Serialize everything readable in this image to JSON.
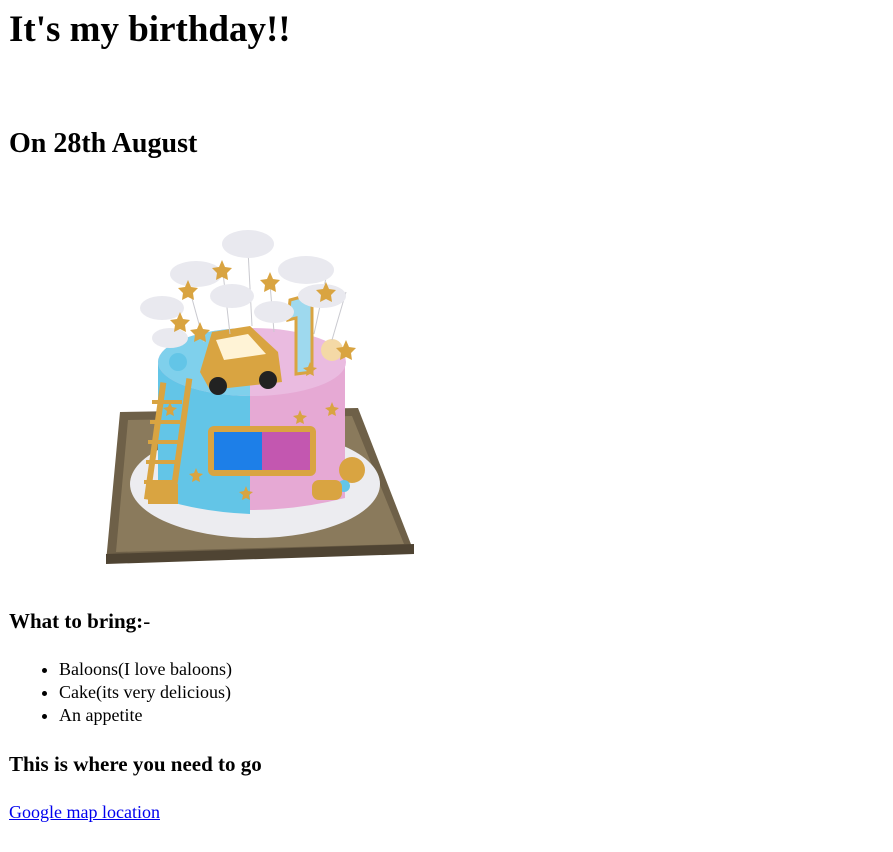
{
  "header": {
    "title": "It's my birthday!!",
    "date": "On 28th August"
  },
  "cake_image": {
    "icon": "birthday-cake-image",
    "colors": {
      "blue": "#5cc6e8",
      "pink": "#e3a9d6",
      "gold": "#d9a441",
      "board": "#6e6048"
    }
  },
  "bring": {
    "heading": "What to bring:",
    "heading_tail": "-",
    "items": [
      "Baloons(I love baloons)",
      "Cake(its very delicious)",
      "An appetite"
    ]
  },
  "location": {
    "heading": "This is where you need to go",
    "link_text": "Google map location",
    "link_color": "#0000ee"
  }
}
